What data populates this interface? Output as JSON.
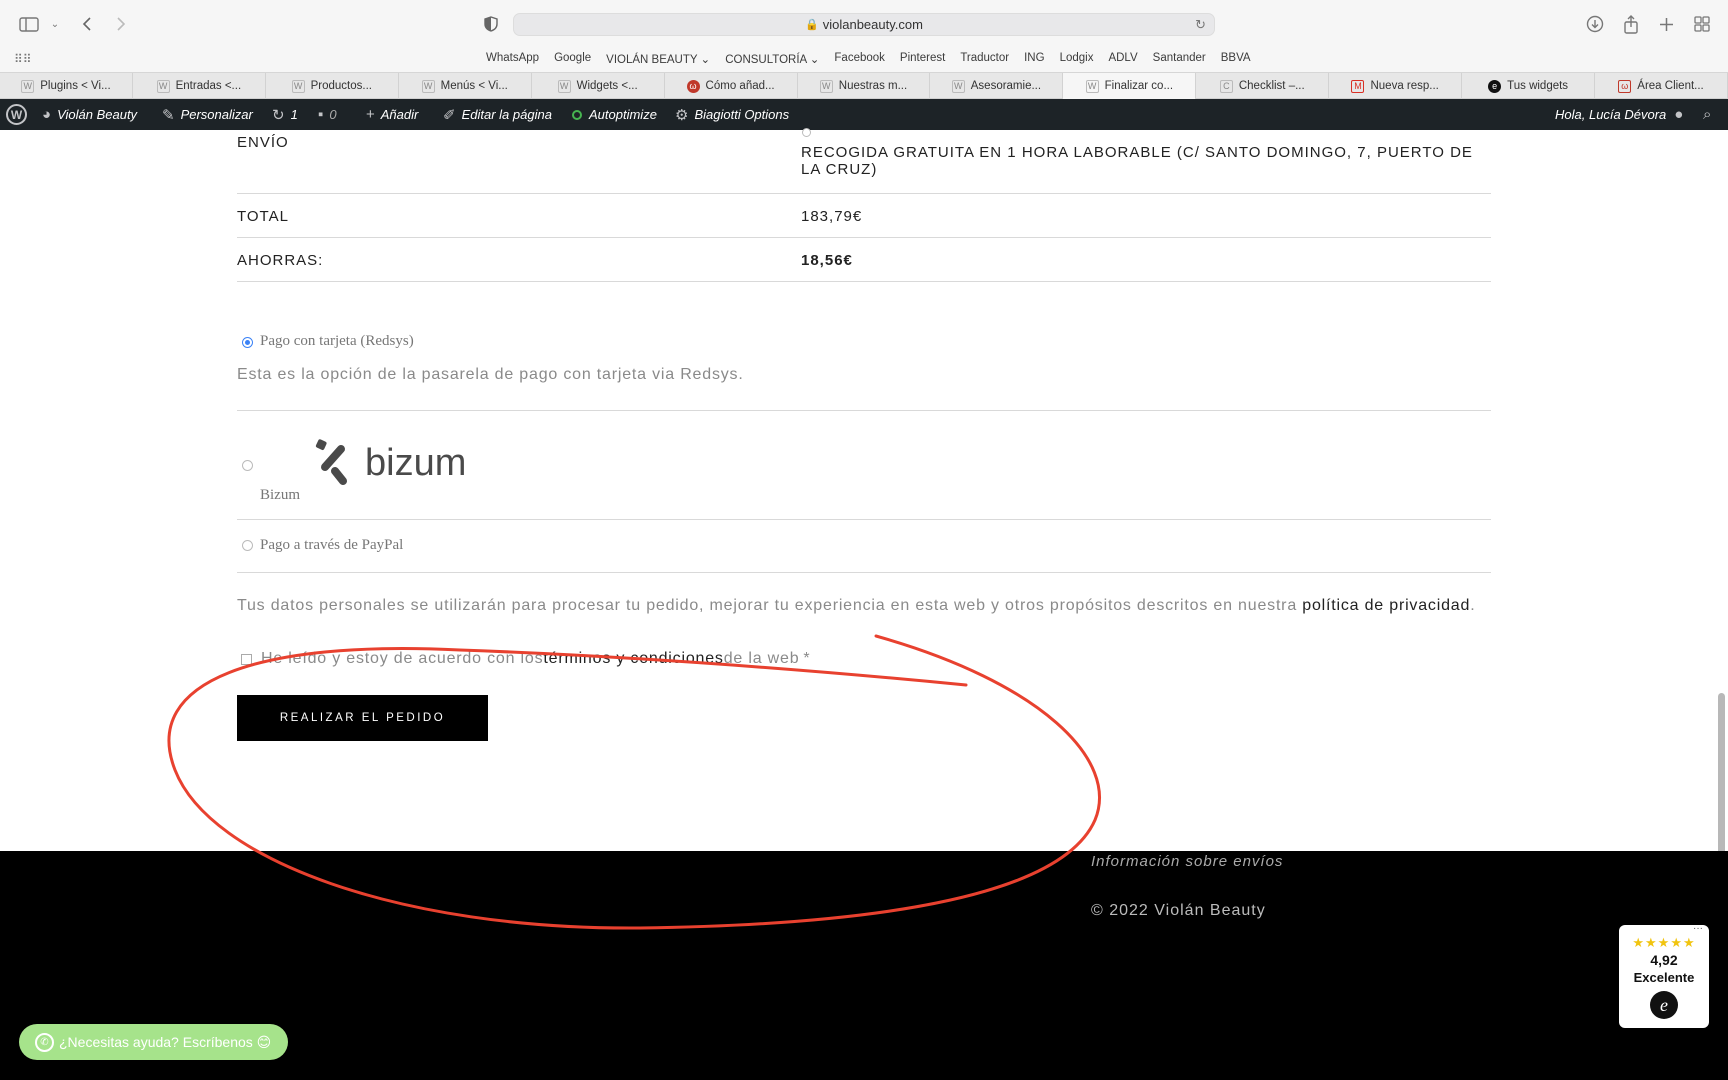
{
  "browser": {
    "url": "violanbeauty.com",
    "favorites": [
      "WhatsApp",
      "Google",
      "VIOLÁN BEAUTY",
      "CONSULTORÍA",
      "Facebook",
      "Pinterest",
      "Traductor",
      "ING",
      "Lodgix",
      "ADLV",
      "Santander",
      "BBVA"
    ],
    "tabs": [
      "Plugins < Vi...",
      "Entradas <...",
      "Productos...",
      "Menús < Vi...",
      "Widgets <...",
      "Cómo añad...",
      "Nuestras m...",
      "Asesoramie...",
      "Finalizar co...",
      "Checklist –...",
      "Nueva resp...",
      "Tus widgets",
      "Área Client..."
    ],
    "active_tab_index": 8
  },
  "adminbar": {
    "site": "Violán Beauty",
    "customize": "Personalizar",
    "updates": "1",
    "comments": "0",
    "add": "Añadir",
    "edit": "Editar la página",
    "autoptimize": "Autoptimize",
    "biagiotti": "Biagiotti Options",
    "greeting": "Hola, Lucía Dévora"
  },
  "checkout": {
    "shipping_label": "ENVÍO",
    "shipping_value": "RECOGIDA GRATUITA EN 1 HORA LABORABLE (C/ SANTO DOMINGO, 7, PUERTO DE LA CRUZ)",
    "total_label": "TOTAL",
    "total_value": "183,79€",
    "savings_label": "AHORRAS:",
    "savings_value": "18,56€",
    "payment_card": "Pago con tarjeta (Redsys)",
    "payment_card_desc": "Esta es la opción de la pasarela de pago con tarjeta via Redsys.",
    "payment_bizum": "Bizum",
    "bizum_logo": "bizum",
    "payment_paypal": "Pago a través de PayPal",
    "privacy_text": "Tus datos personales se utilizarán para procesar tu pedido, mejorar tu experiencia en esta web y otros propósitos descritos en nuestra ",
    "privacy_link": "política de privacidad",
    "privacy_end": ".",
    "terms_pre": "He leído y estoy de acuerdo con los ",
    "terms_link": "términos y condiciones",
    "terms_post": " de la web ",
    "terms_req": "*",
    "order_button": "REALIZAR EL PEDIDO"
  },
  "footer": {
    "shipping_info": "Información sobre envíos",
    "copyright": "© 2022 Violán Beauty"
  },
  "whatsapp": {
    "label": "¿Necesitas ayuda? Escríbenos 😊"
  },
  "trust_badge": {
    "stars": "★★★★★",
    "score": "4,92",
    "rating": "Excelente",
    "logo": "e"
  },
  "colors": {
    "annotation": "#e8412f",
    "adminbar": "#1d2327",
    "whatsapp": "#a6e38b"
  }
}
